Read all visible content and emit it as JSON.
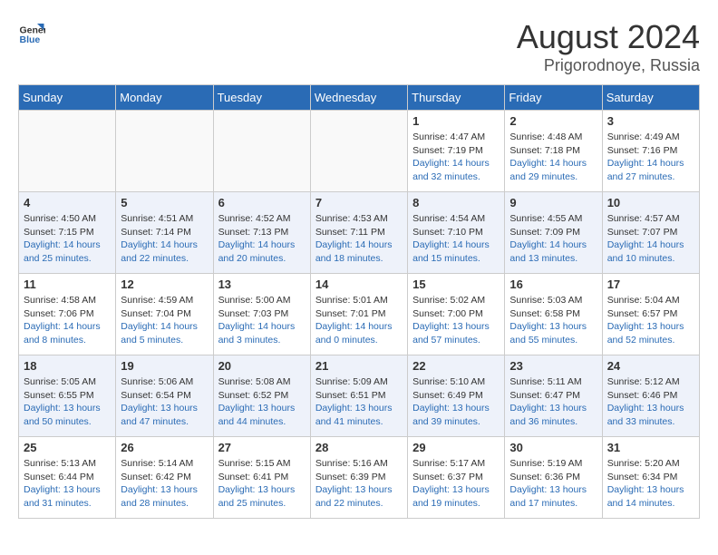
{
  "header": {
    "logo_general": "General",
    "logo_blue": "Blue",
    "month": "August 2024",
    "location": "Prigorodnoye, Russia"
  },
  "weekdays": [
    "Sunday",
    "Monday",
    "Tuesday",
    "Wednesday",
    "Thursday",
    "Friday",
    "Saturday"
  ],
  "weeks": [
    [
      {
        "day": "",
        "empty": true
      },
      {
        "day": "",
        "empty": true
      },
      {
        "day": "",
        "empty": true
      },
      {
        "day": "",
        "empty": true
      },
      {
        "day": "1",
        "sunrise": "Sunrise: 4:47 AM",
        "sunset": "Sunset: 7:19 PM",
        "daylight": "Daylight: 14 hours and 32 minutes."
      },
      {
        "day": "2",
        "sunrise": "Sunrise: 4:48 AM",
        "sunset": "Sunset: 7:18 PM",
        "daylight": "Daylight: 14 hours and 29 minutes."
      },
      {
        "day": "3",
        "sunrise": "Sunrise: 4:49 AM",
        "sunset": "Sunset: 7:16 PM",
        "daylight": "Daylight: 14 hours and 27 minutes."
      }
    ],
    [
      {
        "day": "4",
        "sunrise": "Sunrise: 4:50 AM",
        "sunset": "Sunset: 7:15 PM",
        "daylight": "Daylight: 14 hours and 25 minutes."
      },
      {
        "day": "5",
        "sunrise": "Sunrise: 4:51 AM",
        "sunset": "Sunset: 7:14 PM",
        "daylight": "Daylight: 14 hours and 22 minutes."
      },
      {
        "day": "6",
        "sunrise": "Sunrise: 4:52 AM",
        "sunset": "Sunset: 7:13 PM",
        "daylight": "Daylight: 14 hours and 20 minutes."
      },
      {
        "day": "7",
        "sunrise": "Sunrise: 4:53 AM",
        "sunset": "Sunset: 7:11 PM",
        "daylight": "Daylight: 14 hours and 18 minutes."
      },
      {
        "day": "8",
        "sunrise": "Sunrise: 4:54 AM",
        "sunset": "Sunset: 7:10 PM",
        "daylight": "Daylight: 14 hours and 15 minutes."
      },
      {
        "day": "9",
        "sunrise": "Sunrise: 4:55 AM",
        "sunset": "Sunset: 7:09 PM",
        "daylight": "Daylight: 14 hours and 13 minutes."
      },
      {
        "day": "10",
        "sunrise": "Sunrise: 4:57 AM",
        "sunset": "Sunset: 7:07 PM",
        "daylight": "Daylight: 14 hours and 10 minutes."
      }
    ],
    [
      {
        "day": "11",
        "sunrise": "Sunrise: 4:58 AM",
        "sunset": "Sunset: 7:06 PM",
        "daylight": "Daylight: 14 hours and 8 minutes."
      },
      {
        "day": "12",
        "sunrise": "Sunrise: 4:59 AM",
        "sunset": "Sunset: 7:04 PM",
        "daylight": "Daylight: 14 hours and 5 minutes."
      },
      {
        "day": "13",
        "sunrise": "Sunrise: 5:00 AM",
        "sunset": "Sunset: 7:03 PM",
        "daylight": "Daylight: 14 hours and 3 minutes."
      },
      {
        "day": "14",
        "sunrise": "Sunrise: 5:01 AM",
        "sunset": "Sunset: 7:01 PM",
        "daylight": "Daylight: 14 hours and 0 minutes."
      },
      {
        "day": "15",
        "sunrise": "Sunrise: 5:02 AM",
        "sunset": "Sunset: 7:00 PM",
        "daylight": "Daylight: 13 hours and 57 minutes."
      },
      {
        "day": "16",
        "sunrise": "Sunrise: 5:03 AM",
        "sunset": "Sunset: 6:58 PM",
        "daylight": "Daylight: 13 hours and 55 minutes."
      },
      {
        "day": "17",
        "sunrise": "Sunrise: 5:04 AM",
        "sunset": "Sunset: 6:57 PM",
        "daylight": "Daylight: 13 hours and 52 minutes."
      }
    ],
    [
      {
        "day": "18",
        "sunrise": "Sunrise: 5:05 AM",
        "sunset": "Sunset: 6:55 PM",
        "daylight": "Daylight: 13 hours and 50 minutes."
      },
      {
        "day": "19",
        "sunrise": "Sunrise: 5:06 AM",
        "sunset": "Sunset: 6:54 PM",
        "daylight": "Daylight: 13 hours and 47 minutes."
      },
      {
        "day": "20",
        "sunrise": "Sunrise: 5:08 AM",
        "sunset": "Sunset: 6:52 PM",
        "daylight": "Daylight: 13 hours and 44 minutes."
      },
      {
        "day": "21",
        "sunrise": "Sunrise: 5:09 AM",
        "sunset": "Sunset: 6:51 PM",
        "daylight": "Daylight: 13 hours and 41 minutes."
      },
      {
        "day": "22",
        "sunrise": "Sunrise: 5:10 AM",
        "sunset": "Sunset: 6:49 PM",
        "daylight": "Daylight: 13 hours and 39 minutes."
      },
      {
        "day": "23",
        "sunrise": "Sunrise: 5:11 AM",
        "sunset": "Sunset: 6:47 PM",
        "daylight": "Daylight: 13 hours and 36 minutes."
      },
      {
        "day": "24",
        "sunrise": "Sunrise: 5:12 AM",
        "sunset": "Sunset: 6:46 PM",
        "daylight": "Daylight: 13 hours and 33 minutes."
      }
    ],
    [
      {
        "day": "25",
        "sunrise": "Sunrise: 5:13 AM",
        "sunset": "Sunset: 6:44 PM",
        "daylight": "Daylight: 13 hours and 31 minutes."
      },
      {
        "day": "26",
        "sunrise": "Sunrise: 5:14 AM",
        "sunset": "Sunset: 6:42 PM",
        "daylight": "Daylight: 13 hours and 28 minutes."
      },
      {
        "day": "27",
        "sunrise": "Sunrise: 5:15 AM",
        "sunset": "Sunset: 6:41 PM",
        "daylight": "Daylight: 13 hours and 25 minutes."
      },
      {
        "day": "28",
        "sunrise": "Sunrise: 5:16 AM",
        "sunset": "Sunset: 6:39 PM",
        "daylight": "Daylight: 13 hours and 22 minutes."
      },
      {
        "day": "29",
        "sunrise": "Sunrise: 5:17 AM",
        "sunset": "Sunset: 6:37 PM",
        "daylight": "Daylight: 13 hours and 19 minutes."
      },
      {
        "day": "30",
        "sunrise": "Sunrise: 5:19 AM",
        "sunset": "Sunset: 6:36 PM",
        "daylight": "Daylight: 13 hours and 17 minutes."
      },
      {
        "day": "31",
        "sunrise": "Sunrise: 5:20 AM",
        "sunset": "Sunset: 6:34 PM",
        "daylight": "Daylight: 13 hours and 14 minutes."
      }
    ]
  ]
}
